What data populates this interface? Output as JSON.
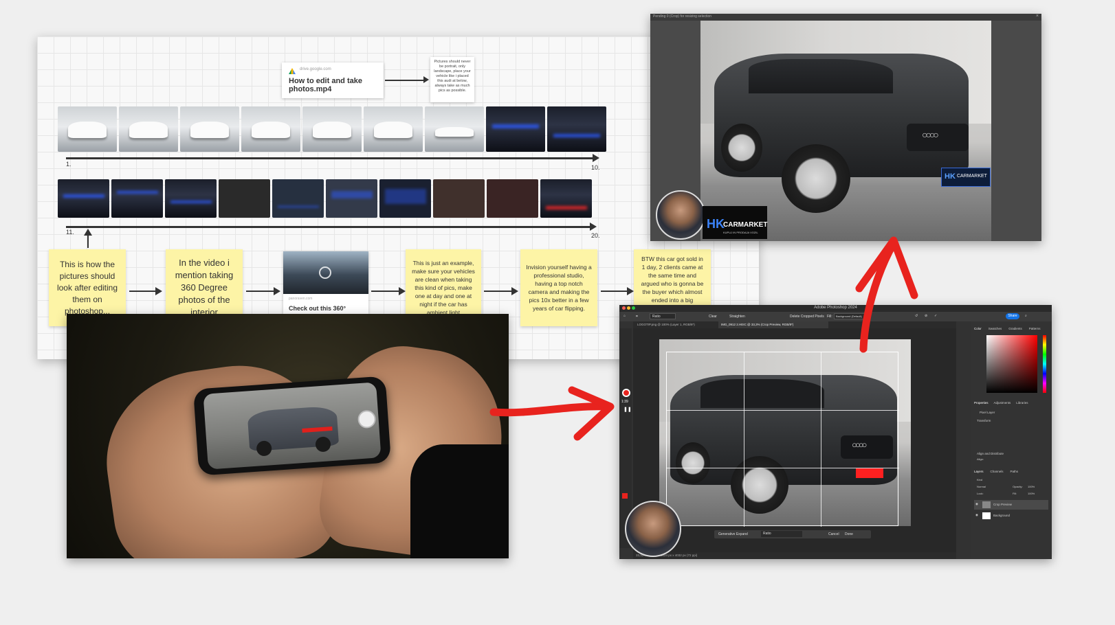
{
  "board": {
    "video_card": {
      "source": "drive.google.com",
      "title": "How to edit and take photos.mp4"
    },
    "note_top": "Pictures should never be portrait, only landscape, place your vehicle like i placed this audi at below, always take as much pics as possible.",
    "timeline1": {
      "start": "1.",
      "end": "10."
    },
    "timeline2": {
      "start": "11.",
      "end": "20."
    },
    "stickies": [
      "This is how the pictures should look after editing them on photoshop...",
      "In the video i mention taking 360 Degree photos of the interior",
      "This is just an example, make sure your vehicles are clean when taking this kind of pics, make one at day and one at night if the car has ambient light",
      "Invision yourself having a professional studio, having a top notch camera and making the pics 10x better in a few years of car flipping.",
      "BTW this car got sold in 1 day, 2 clients came at the same time and argued who is gonna be the buyer which almost ended into a big"
    ],
    "link_card": {
      "source": "panoraven.com",
      "title": "Check out this 360°"
    }
  },
  "ps_top": {
    "title": "Pending 0 (Crop) for resizing selection",
    "brand": {
      "hk": "HK",
      "name": "CARMARKET",
      "tagline": "KUPUJ IN PRODAJA VOZIL"
    }
  },
  "ps_main": {
    "app_title": "Adobe Photoshop 2024",
    "tabs": [
      "LOGOTIP.png @ 100% (Layer 1, RGB/8*)",
      "IMG_0912 2.HEIC @ 33,3% (Crop Preview, RGB/8*)"
    ],
    "options": {
      "ratio": "Ratio",
      "clear": "Clear",
      "straighten": "Straighten",
      "delete_cropped": "Delete Cropped Pixels",
      "fill": "Fill:",
      "fill_value": "Background (Default)"
    },
    "share": "Share",
    "recording_time": "1:39",
    "context_bar": {
      "generative_expand": "Generative Expand",
      "ratio": "Ratio",
      "cancel": "Cancel",
      "done": "Done"
    },
    "status": {
      "zoom": "33,33%",
      "size": "3024 px x 4032 px (72 ppi)"
    },
    "panel_tabs": [
      "Color",
      "Swatches",
      "Gradients",
      "Patterns"
    ],
    "properties_tabs": [
      "Properties",
      "Adjustments",
      "Libraries"
    ],
    "properties": {
      "pixel_layer": "Pixel Layer",
      "transform": "Transform",
      "align": "Align and Distribute",
      "align_label": "Align:"
    },
    "layers_tabs": [
      "Layers",
      "Channels",
      "Paths"
    ],
    "layers_controls": {
      "kind": "Kind",
      "blend": "Normal",
      "opacity_label": "Opacity:",
      "opacity": "100%",
      "fill_label": "Fill:",
      "fill": "100%",
      "lock": "Lock:"
    },
    "layers": [
      {
        "name": "Crop Preview"
      },
      {
        "name": "Background"
      }
    ]
  },
  "colors": {
    "sticky": "#fdf4a6",
    "red_arrow": "#e8231e",
    "ps_bg": "#323232",
    "share_blue": "#1473e6"
  }
}
